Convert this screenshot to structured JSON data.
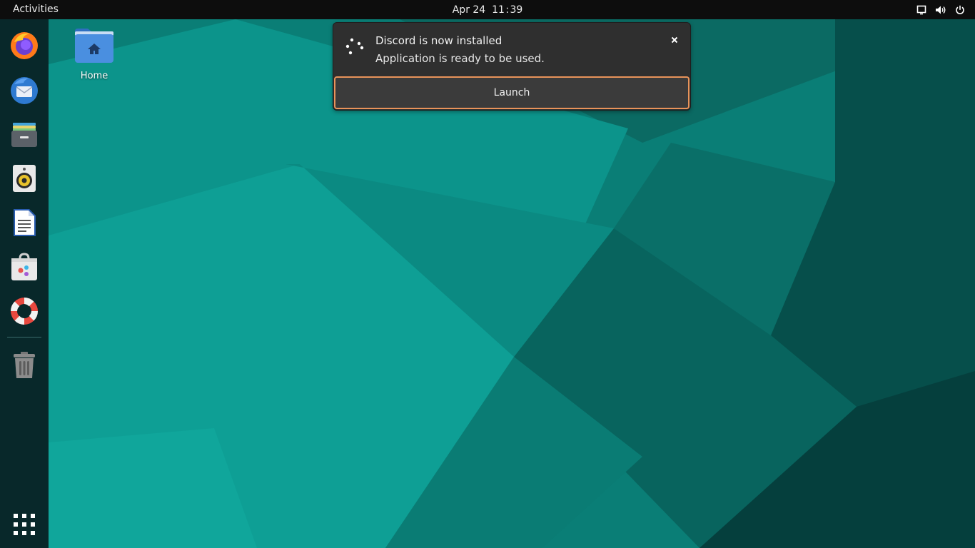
{
  "topbar": {
    "activities_label": "Activities",
    "clock": {
      "date": "Apr 24",
      "time": "11 : 39"
    },
    "tray_icons": [
      "screen-icon",
      "volume-icon",
      "power-icon"
    ]
  },
  "dock": {
    "apps": [
      {
        "name": "Firefox",
        "icon": "firefox-icon"
      },
      {
        "name": "Thunderbird",
        "icon": "thunderbird-icon"
      },
      {
        "name": "Files",
        "icon": "files-icon"
      },
      {
        "name": "Rhythmbox",
        "icon": "rhythmbox-icon"
      },
      {
        "name": "LibreOffice Writer",
        "icon": "writer-icon"
      },
      {
        "name": "Software",
        "icon": "software-icon"
      },
      {
        "name": "Help",
        "icon": "help-icon"
      },
      {
        "name": "Trash",
        "icon": "trash-icon"
      }
    ],
    "show_apps_icon": "app-grid-icon"
  },
  "desktop": {
    "home_label": "Home"
  },
  "notification": {
    "title": "Discord is now installed",
    "body": "Application is ready to be used.",
    "action_label": "Launch",
    "accent_color": "#e8935a"
  },
  "colors": {
    "topbar_bg": "#0d0d0d",
    "dock_bg": "#08282a",
    "wallpaper_teal": "#0a9a90"
  }
}
